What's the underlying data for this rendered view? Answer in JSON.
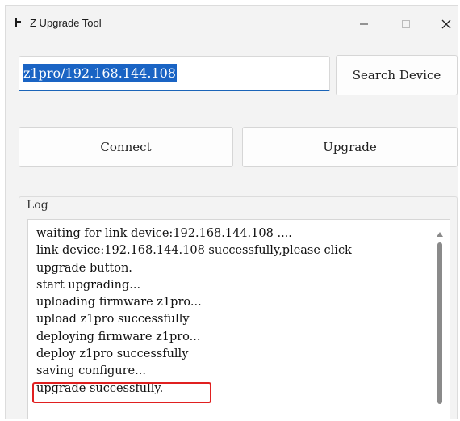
{
  "window": {
    "title": "Z Upgrade Tool",
    "icons": {
      "app": "app-icon",
      "minimize": "minimize-icon",
      "maximize": "maximize-icon",
      "close": "close-icon"
    }
  },
  "connection": {
    "address_value": "z1pro/192.168.144.108",
    "search_label": "Search Device",
    "connect_label": "Connect",
    "upgrade_label": "Upgrade"
  },
  "log": {
    "label": "Log",
    "lines": [
      "waiting for link device:192.168.144.108 ....",
      "link device:192.168.144.108 successfully,please click",
      "upgrade button.",
      "start upgrading...",
      "uploading firmware z1pro...",
      "upload z1pro successfully",
      "deploying firmware z1pro...",
      "deploy z1pro successfully",
      "saving configure...",
      "upgrade successfully."
    ],
    "highlighted_line_index": 9
  },
  "colors": {
    "selection": "#1a64c4",
    "input_underline": "#1a64b8",
    "highlight_border": "#e02020",
    "window_bg": "#f3f3f3"
  }
}
